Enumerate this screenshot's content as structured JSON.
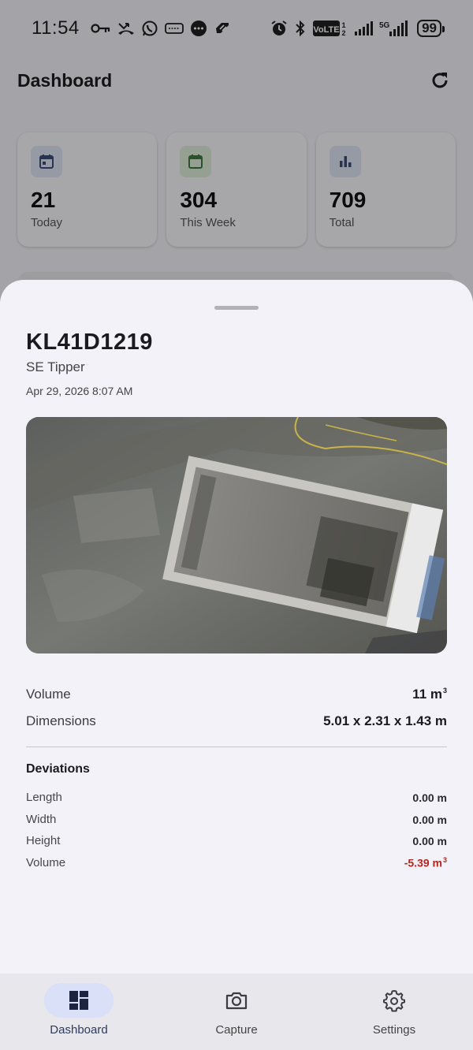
{
  "status_bar": {
    "time": "11:54",
    "battery": "99",
    "network": "5G",
    "volte": "VoLTE"
  },
  "app_bar": {
    "title": "Dashboard"
  },
  "stats": [
    {
      "value": "21",
      "label": "Today",
      "icon": "calendar-icon",
      "color": "#3b4f7a"
    },
    {
      "value": "304",
      "label": "This Week",
      "icon": "calendar-week-icon",
      "color": "#3e7a3e"
    },
    {
      "value": "709",
      "label": "Total",
      "icon": "bar-chart-icon",
      "color": "#3b4f7a"
    }
  ],
  "detail": {
    "vehicle_id": "KL41D1219",
    "vehicle_type": "SE Tipper",
    "timestamp": "Apr 29, 2026 8:07 AM",
    "volume_label": "Volume",
    "volume_value": "11 m",
    "volume_unit_sup": "3",
    "dimensions_label": "Dimensions",
    "dimensions_value": "5.01 x 2.31 x 1.43 m",
    "deviations_title": "Deviations",
    "deviations": [
      {
        "label": "Length",
        "value": "0.00 m"
      },
      {
        "label": "Width",
        "value": "0.00 m"
      },
      {
        "label": "Height",
        "value": "0.00 m"
      },
      {
        "label": "Volume",
        "value": "-5.39 m",
        "sup": "3"
      }
    ]
  },
  "nav": {
    "items": [
      {
        "label": "Dashboard",
        "icon": "dashboard-icon",
        "active": true
      },
      {
        "label": "Capture",
        "icon": "camera-icon",
        "active": false
      },
      {
        "label": "Settings",
        "icon": "gear-icon",
        "active": false
      }
    ]
  },
  "colors": {
    "accent": "#d9e0f7",
    "negative": "#b3261e",
    "sheet": "#f3f2f8"
  }
}
